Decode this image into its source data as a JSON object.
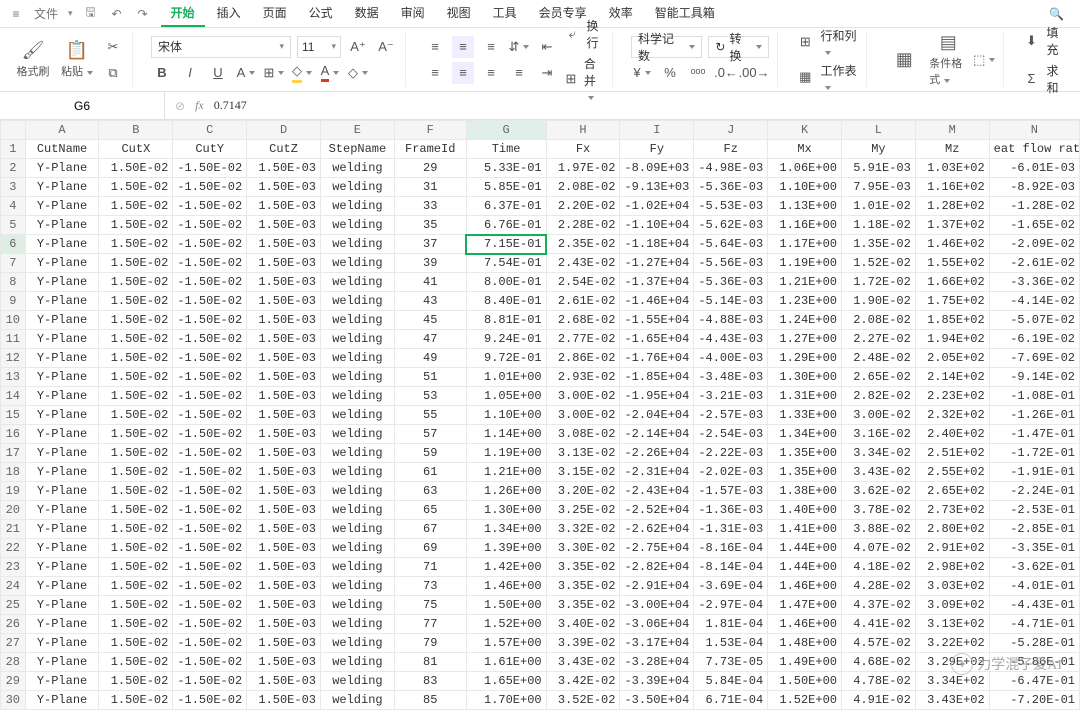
{
  "qat": {
    "file": "文件"
  },
  "menu": {
    "items": [
      "开始",
      "插入",
      "页面",
      "公式",
      "数据",
      "审阅",
      "视图",
      "工具",
      "会员专享",
      "效率",
      "智能工具箱"
    ],
    "active": 0
  },
  "ribbon": {
    "clip": {
      "format_painter": "格式刷",
      "paste": "粘贴"
    },
    "font": {
      "name": "宋体",
      "size": "11",
      "bold": "B",
      "italic": "I",
      "underline": "U"
    },
    "align": {
      "wrap": "换行",
      "merge": "合并"
    },
    "number": {
      "format": "科学记数",
      "convert": "转换"
    },
    "cells": {
      "rowscols": "行和列",
      "worksheet": "工作表"
    },
    "style": {
      "condfmt": "条件格式"
    },
    "edit": {
      "fill": "填充",
      "sum": "求和"
    }
  },
  "ref": {
    "cell": "G6",
    "fx_icon": "fx",
    "value": "0.7147"
  },
  "columns": [
    "A",
    "B",
    "C",
    "D",
    "E",
    "F",
    "G",
    "H",
    "I",
    "J",
    "K",
    "L",
    "M",
    "N"
  ],
  "headers": [
    "CutName",
    "CutX",
    "CutY",
    "CutZ",
    "StepName",
    "FrameId",
    "Time",
    "Fx",
    "Fy",
    "Fz",
    "Mx",
    "My",
    "Mz",
    "eat flow rate"
  ],
  "activeCol": "G",
  "activeRow": 6,
  "rows": [
    [
      "Y-Plane",
      "1.50E-02",
      "-1.50E-02",
      "1.50E-03",
      "welding",
      "29",
      "5.33E-01",
      "1.97E-02",
      "-8.09E+03",
      "-4.98E-03",
      "1.06E+00",
      "5.91E-03",
      "1.03E+02",
      "-6.01E-03"
    ],
    [
      "Y-Plane",
      "1.50E-02",
      "-1.50E-02",
      "1.50E-03",
      "welding",
      "31",
      "5.85E-01",
      "2.08E-02",
      "-9.13E+03",
      "-5.36E-03",
      "1.10E+00",
      "7.95E-03",
      "1.16E+02",
      "-8.92E-03"
    ],
    [
      "Y-Plane",
      "1.50E-02",
      "-1.50E-02",
      "1.50E-03",
      "welding",
      "33",
      "6.37E-01",
      "2.20E-02",
      "-1.02E+04",
      "-5.53E-03",
      "1.13E+00",
      "1.01E-02",
      "1.28E+02",
      "-1.28E-02"
    ],
    [
      "Y-Plane",
      "1.50E-02",
      "-1.50E-02",
      "1.50E-03",
      "welding",
      "35",
      "6.76E-01",
      "2.28E-02",
      "-1.10E+04",
      "-5.62E-03",
      "1.16E+00",
      "1.18E-02",
      "1.37E+02",
      "-1.65E-02"
    ],
    [
      "Y-Plane",
      "1.50E-02",
      "-1.50E-02",
      "1.50E-03",
      "welding",
      "37",
      "7.15E-01",
      "2.35E-02",
      "-1.18E+04",
      "-5.64E-03",
      "1.17E+00",
      "1.35E-02",
      "1.46E+02",
      "-2.09E-02"
    ],
    [
      "Y-Plane",
      "1.50E-02",
      "-1.50E-02",
      "1.50E-03",
      "welding",
      "39",
      "7.54E-01",
      "2.43E-02",
      "-1.27E+04",
      "-5.56E-03",
      "1.19E+00",
      "1.52E-02",
      "1.55E+02",
      "-2.61E-02"
    ],
    [
      "Y-Plane",
      "1.50E-02",
      "-1.50E-02",
      "1.50E-03",
      "welding",
      "41",
      "8.00E-01",
      "2.54E-02",
      "-1.37E+04",
      "-5.36E-03",
      "1.21E+00",
      "1.72E-02",
      "1.66E+02",
      "-3.36E-02"
    ],
    [
      "Y-Plane",
      "1.50E-02",
      "-1.50E-02",
      "1.50E-03",
      "welding",
      "43",
      "8.40E-01",
      "2.61E-02",
      "-1.46E+04",
      "-5.14E-03",
      "1.23E+00",
      "1.90E-02",
      "1.75E+02",
      "-4.14E-02"
    ],
    [
      "Y-Plane",
      "1.50E-02",
      "-1.50E-02",
      "1.50E-03",
      "welding",
      "45",
      "8.81E-01",
      "2.68E-02",
      "-1.55E+04",
      "-4.88E-03",
      "1.24E+00",
      "2.08E-02",
      "1.85E+02",
      "-5.07E-02"
    ],
    [
      "Y-Plane",
      "1.50E-02",
      "-1.50E-02",
      "1.50E-03",
      "welding",
      "47",
      "9.24E-01",
      "2.77E-02",
      "-1.65E+04",
      "-4.43E-03",
      "1.27E+00",
      "2.27E-02",
      "1.94E+02",
      "-6.19E-02"
    ],
    [
      "Y-Plane",
      "1.50E-02",
      "-1.50E-02",
      "1.50E-03",
      "welding",
      "49",
      "9.72E-01",
      "2.86E-02",
      "-1.76E+04",
      "-4.00E-03",
      "1.29E+00",
      "2.48E-02",
      "2.05E+02",
      "-7.69E-02"
    ],
    [
      "Y-Plane",
      "1.50E-02",
      "-1.50E-02",
      "1.50E-03",
      "welding",
      "51",
      "1.01E+00",
      "2.93E-02",
      "-1.85E+04",
      "-3.48E-03",
      "1.30E+00",
      "2.65E-02",
      "2.14E+02",
      "-9.14E-02"
    ],
    [
      "Y-Plane",
      "1.50E-02",
      "-1.50E-02",
      "1.50E-03",
      "welding",
      "53",
      "1.05E+00",
      "3.00E-02",
      "-1.95E+04",
      "-3.21E-03",
      "1.31E+00",
      "2.82E-02",
      "2.23E+02",
      "-1.08E-01"
    ],
    [
      "Y-Plane",
      "1.50E-02",
      "-1.50E-02",
      "1.50E-03",
      "welding",
      "55",
      "1.10E+00",
      "3.00E-02",
      "-2.04E+04",
      "-2.57E-03",
      "1.33E+00",
      "3.00E-02",
      "2.32E+02",
      "-1.26E-01"
    ],
    [
      "Y-Plane",
      "1.50E-02",
      "-1.50E-02",
      "1.50E-03",
      "welding",
      "57",
      "1.14E+00",
      "3.08E-02",
      "-2.14E+04",
      "-2.54E-03",
      "1.34E+00",
      "3.16E-02",
      "2.40E+02",
      "-1.47E-01"
    ],
    [
      "Y-Plane",
      "1.50E-02",
      "-1.50E-02",
      "1.50E-03",
      "welding",
      "59",
      "1.19E+00",
      "3.13E-02",
      "-2.26E+04",
      "-2.22E-03",
      "1.35E+00",
      "3.34E-02",
      "2.51E+02",
      "-1.72E-01"
    ],
    [
      "Y-Plane",
      "1.50E-02",
      "-1.50E-02",
      "1.50E-03",
      "welding",
      "61",
      "1.21E+00",
      "3.15E-02",
      "-2.31E+04",
      "-2.02E-03",
      "1.35E+00",
      "3.43E-02",
      "2.55E+02",
      "-1.91E-01"
    ],
    [
      "Y-Plane",
      "1.50E-02",
      "-1.50E-02",
      "1.50E-03",
      "welding",
      "63",
      "1.26E+00",
      "3.20E-02",
      "-2.43E+04",
      "-1.57E-03",
      "1.38E+00",
      "3.62E-02",
      "2.65E+02",
      "-2.24E-01"
    ],
    [
      "Y-Plane",
      "1.50E-02",
      "-1.50E-02",
      "1.50E-03",
      "welding",
      "65",
      "1.30E+00",
      "3.25E-02",
      "-2.52E+04",
      "-1.36E-03",
      "1.40E+00",
      "3.78E-02",
      "2.73E+02",
      "-2.53E-01"
    ],
    [
      "Y-Plane",
      "1.50E-02",
      "-1.50E-02",
      "1.50E-03",
      "welding",
      "67",
      "1.34E+00",
      "3.32E-02",
      "-2.62E+04",
      "-1.31E-03",
      "1.41E+00",
      "3.88E-02",
      "2.80E+02",
      "-2.85E-01"
    ],
    [
      "Y-Plane",
      "1.50E-02",
      "-1.50E-02",
      "1.50E-03",
      "welding",
      "69",
      "1.39E+00",
      "3.30E-02",
      "-2.75E+04",
      "-8.16E-04",
      "1.44E+00",
      "4.07E-02",
      "2.91E+02",
      "-3.35E-01"
    ],
    [
      "Y-Plane",
      "1.50E-02",
      "-1.50E-02",
      "1.50E-03",
      "welding",
      "71",
      "1.42E+00",
      "3.35E-02",
      "-2.82E+04",
      "-8.14E-04",
      "1.44E+00",
      "4.18E-02",
      "2.98E+02",
      "-3.62E-01"
    ],
    [
      "Y-Plane",
      "1.50E-02",
      "-1.50E-02",
      "1.50E-03",
      "welding",
      "73",
      "1.46E+00",
      "3.35E-02",
      "-2.91E+04",
      "-3.69E-04",
      "1.46E+00",
      "4.28E-02",
      "3.03E+02",
      "-4.01E-01"
    ],
    [
      "Y-Plane",
      "1.50E-02",
      "-1.50E-02",
      "1.50E-03",
      "welding",
      "75",
      "1.50E+00",
      "3.35E-02",
      "-3.00E+04",
      "-2.97E-04",
      "1.47E+00",
      "4.37E-02",
      "3.09E+02",
      "-4.43E-01"
    ],
    [
      "Y-Plane",
      "1.50E-02",
      "-1.50E-02",
      "1.50E-03",
      "welding",
      "77",
      "1.52E+00",
      "3.40E-02",
      "-3.06E+04",
      "1.81E-04",
      "1.46E+00",
      "4.41E-02",
      "3.13E+02",
      "-4.71E-01"
    ],
    [
      "Y-Plane",
      "1.50E-02",
      "-1.50E-02",
      "1.50E-03",
      "welding",
      "79",
      "1.57E+00",
      "3.39E-02",
      "-3.17E+04",
      "1.53E-04",
      "1.48E+00",
      "4.57E-02",
      "3.22E+02",
      "-5.28E-01"
    ],
    [
      "Y-Plane",
      "1.50E-02",
      "-1.50E-02",
      "1.50E-03",
      "welding",
      "81",
      "1.61E+00",
      "3.43E-02",
      "-3.28E+04",
      "7.73E-05",
      "1.49E+00",
      "4.68E-02",
      "3.29E+02",
      "-5.86E-01"
    ],
    [
      "Y-Plane",
      "1.50E-02",
      "-1.50E-02",
      "1.50E-03",
      "welding",
      "83",
      "1.65E+00",
      "3.42E-02",
      "-3.39E+04",
      "5.84E-04",
      "1.50E+00",
      "4.78E-02",
      "3.34E+02",
      "-6.47E-01"
    ],
    [
      "Y-Plane",
      "1.50E-02",
      "-1.50E-02",
      "1.50E-03",
      "welding",
      "85",
      "1.70E+00",
      "3.52E-02",
      "-3.50E+04",
      "6.71E-04",
      "1.52E+00",
      "4.91E-02",
      "3.43E+02",
      "-7.20E-01"
    ]
  ],
  "watermark": "力学混子爱AI"
}
